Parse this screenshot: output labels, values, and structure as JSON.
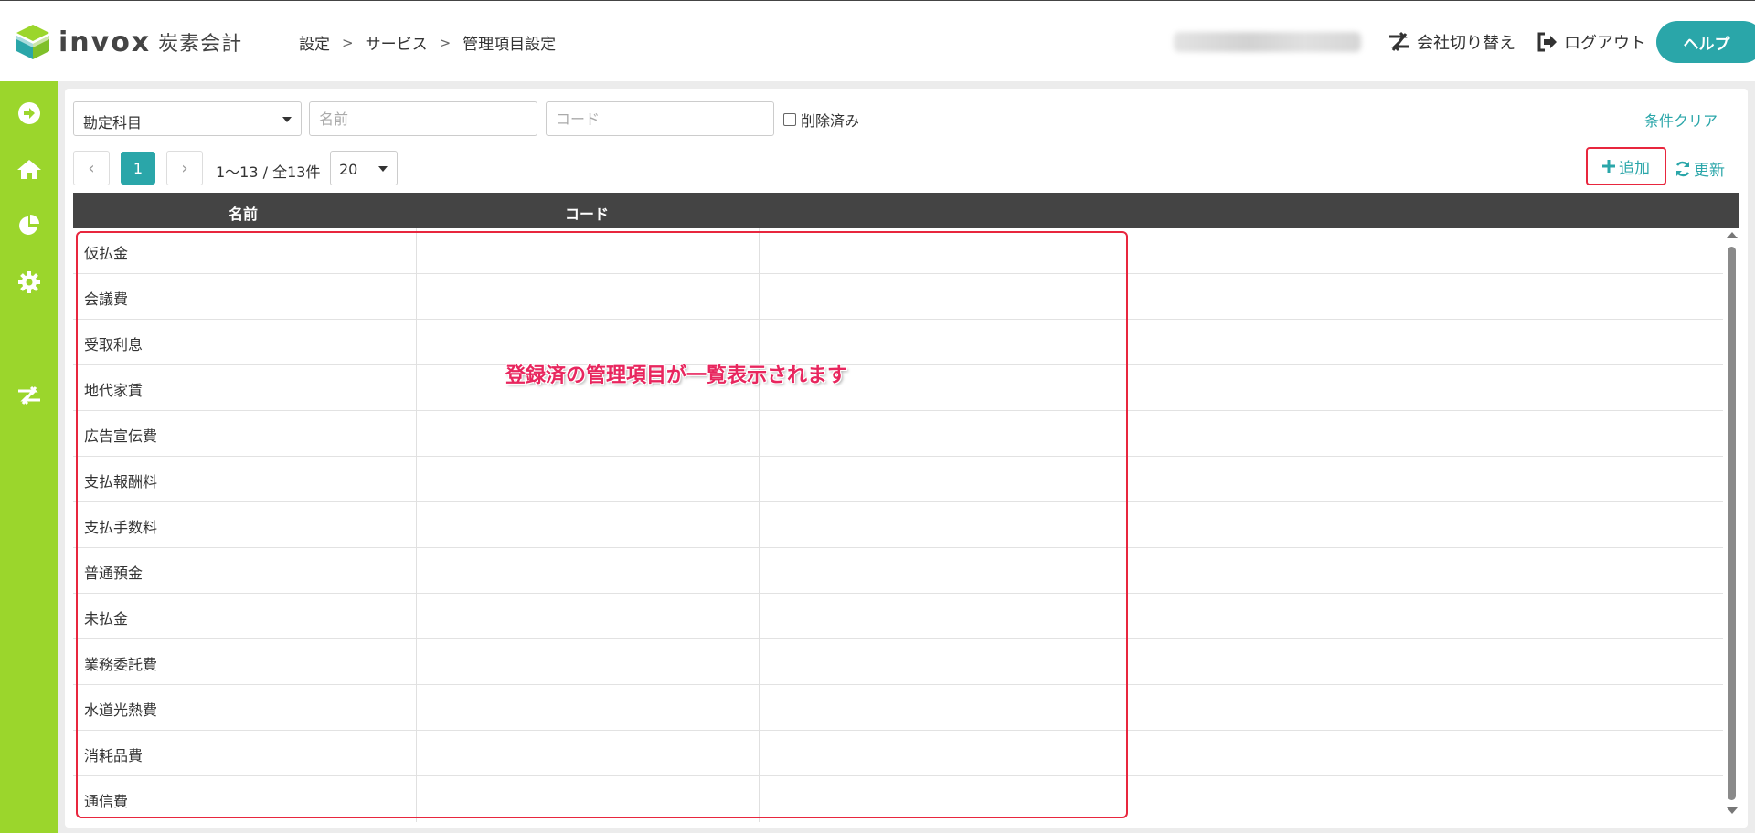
{
  "header": {
    "logo_text": "invox",
    "logo_sub": "炭素会計",
    "breadcrumb": [
      "設定",
      "サービス",
      "管理項目設定"
    ],
    "switch_company": "会社切り替え",
    "logout": "ログアウト",
    "help": "ヘルプ"
  },
  "sidebar": {
    "items": [
      {
        "icon": "arrow-circle-right-icon"
      },
      {
        "icon": "home-icon"
      },
      {
        "icon": "pie-chart-icon"
      },
      {
        "icon": "gear-icon"
      },
      {
        "icon": "switch-icon"
      }
    ]
  },
  "filters": {
    "category_value": "勘定科目",
    "name_placeholder": "名前",
    "code_placeholder": "コード",
    "deleted_label": "削除済み",
    "clear_label": "条件クリア"
  },
  "pagination": {
    "current_page": "1",
    "info": "1〜13 / 全13件",
    "page_size": "20"
  },
  "toolbar": {
    "add_label": "追加",
    "refresh_label": "更新"
  },
  "table": {
    "columns": [
      "名前",
      "コード"
    ],
    "rows": [
      {
        "name": "仮払金",
        "code": ""
      },
      {
        "name": "会議費",
        "code": ""
      },
      {
        "name": "受取利息",
        "code": ""
      },
      {
        "name": "地代家賃",
        "code": ""
      },
      {
        "name": "広告宣伝費",
        "code": ""
      },
      {
        "name": "支払報酬料",
        "code": ""
      },
      {
        "name": "支払手数料",
        "code": ""
      },
      {
        "name": "普通預金",
        "code": ""
      },
      {
        "name": "未払金",
        "code": ""
      },
      {
        "name": "業務委託費",
        "code": ""
      },
      {
        "name": "水道光熱費",
        "code": ""
      },
      {
        "name": "消耗品費",
        "code": ""
      },
      {
        "name": "通信費",
        "code": ""
      }
    ]
  },
  "annotation": {
    "text": "登録済の管理項目が一覧表示されます",
    "color": "#e8265e"
  },
  "colors": {
    "accent": "#2aa6a9",
    "sidebar": "#9bd62c",
    "highlight": "#e8263e",
    "table_header": "#444444"
  }
}
